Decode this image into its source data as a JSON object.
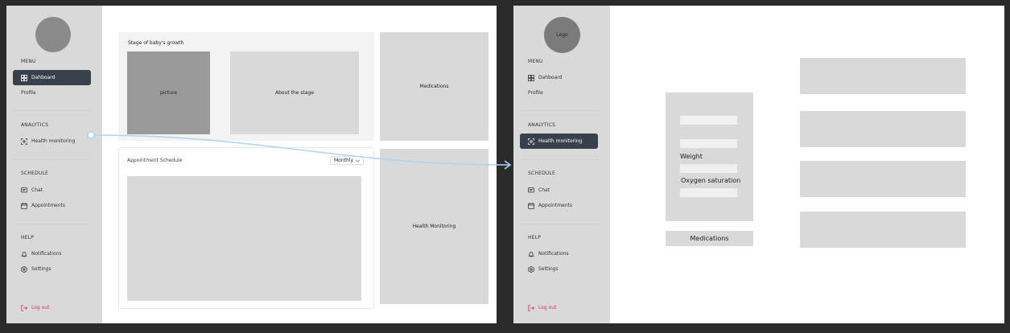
{
  "frame1": {
    "menu_label": "MENU",
    "nav": {
      "dashboard": "Dahboard",
      "profile": "Profile",
      "analytics_label": "ANALYTICS",
      "health": "Health monitoring",
      "schedule_label": "SCHEDULE",
      "chat": "Chat",
      "appointments": "Appointments",
      "help_label": "HELP",
      "notifications": "Notifications",
      "settings": "Settings",
      "logout": "Log out"
    },
    "growth": {
      "title": "Stage of baby's growth",
      "picture": "picture",
      "about": "About the stage"
    },
    "medications": "Medications",
    "appointment": {
      "title": "Appointment Schedule",
      "period": "Monthly"
    },
    "health_monitoring": "Health Monitoring"
  },
  "frame2": {
    "logo": "Logo",
    "menu_label": "MENU",
    "nav": {
      "dashboard": "Dahboard",
      "profile": "Profile",
      "analytics_label": "ANALYTICS",
      "health": "Health monitoring",
      "schedule_label": "SCHEDULE",
      "chat": "Chat",
      "appointments": "Appointments",
      "help_label": "HELP",
      "notifications": "Notifications",
      "settings": "Settings",
      "logout": "Log out"
    },
    "form": {
      "weight": "Weight",
      "oxygen": "Oxygen saturation"
    },
    "medications": "Medications"
  },
  "colors": {
    "accent": "#37414b",
    "logout": "#d6335a",
    "connector": "#a9d6f5"
  }
}
